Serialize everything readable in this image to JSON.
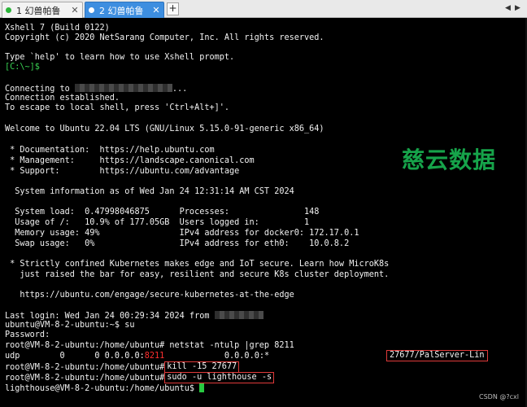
{
  "tabs": [
    {
      "label": "1 幻兽帕鲁",
      "close": "✕"
    },
    {
      "label": "2 幻兽帕鲁",
      "close": "✕"
    }
  ],
  "tabbar": {
    "add": "+",
    "nav_left": "◀",
    "nav_right": "▶"
  },
  "terminal": {
    "lines": [
      "Xshell 7 (Build 0122)",
      "Copyright (c) 2020 NetSarang Computer, Inc. All rights reserved.",
      "",
      "Type `help' to learn how to use Xshell prompt.",
      "[C:\\~]$",
      "",
      "Connecting to ",
      "Connection established.",
      "To escape to local shell, press 'Ctrl+Alt+]'.",
      "",
      "Welcome to Ubuntu 22.04 LTS (GNU/Linux 5.15.0-91-generic x86_64)",
      "",
      " * Documentation:  https://help.ubuntu.com",
      " * Management:     https://landscape.canonical.com",
      " * Support:        https://ubuntu.com/advantage",
      "",
      "  System information as of Wed Jan 24 12:31:14 AM CST 2024",
      "",
      "  System load:  0.47998046875      Processes:               148",
      "  Usage of /:   10.9% of 177.05GB  Users logged in:         1",
      "  Memory usage: 49%                IPv4 address for docker0: 172.17.0.1",
      "  Swap usage:   0%                 IPv4 address for eth0:    10.0.8.2",
      "",
      " * Strictly confined Kubernetes makes edge and IoT secure. Learn how MicroK8s",
      "   just raised the bar for easy, resilient and secure K8s cluster deployment.",
      "",
      "   https://ubuntu.com/engage/secure-kubernetes-at-the-edge",
      "",
      "Last login: Wed Jan 24 00:29:34 2024 from ",
      "ubuntu@VM-8-2-ubuntu:~$ su",
      "Password:",
      "root@VM-8-2-ubuntu:/home/ubuntu# netstat -ntulp |grep 8211"
    ],
    "connecting_suffix": "...",
    "udp_line": {
      "prefix": "udp        0      0 0.0.0.0:",
      "port": "8211",
      "middle": "            0.0.0.0:*",
      "process": "27677/PalServer-Lin"
    },
    "root_prompt": "root@VM-8-2-ubuntu:/home/ubuntu#",
    "kill_cmd": "kill -15 27677",
    "sudo_cmd": "sudo -u lighthouse -s",
    "final_prompt": "lighthouse@VM-8-2-ubuntu:/home/ubuntu$ "
  },
  "watermark": "慈云数据",
  "credit": "CSDN @?cxl",
  "colors": {
    "prompt_green": "#39d353",
    "port_red": "#ff2f2f",
    "highlight_box": "#e03a3a",
    "active_tab": "#3d8ee0"
  }
}
